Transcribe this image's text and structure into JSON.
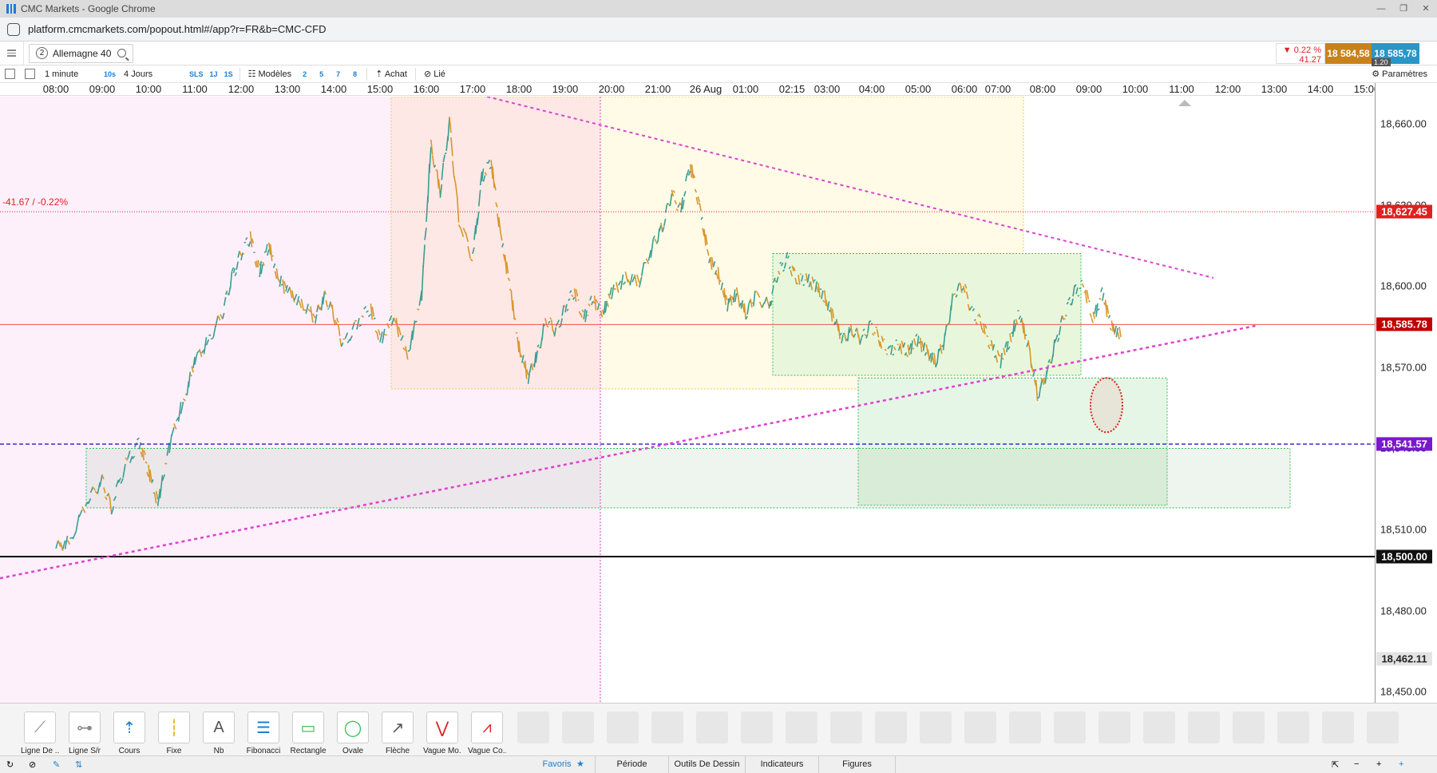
{
  "window": {
    "title": "CMC Markets - Google Chrome",
    "minimize": "—",
    "restore": "❐",
    "close": "✕"
  },
  "browser": {
    "url": "platform.cmcmarkets.com/popout.html#/app?r=FR&b=CMC-CFD"
  },
  "instrument": {
    "index": "2",
    "name": "Allemagne 40"
  },
  "quote": {
    "change_pct": "▼ 0.22 %",
    "change_pts": "41.27",
    "sell": "18 584,58",
    "buy": "18 585,78",
    "spread": "1.20"
  },
  "toolbar": {
    "interval": "1 minute",
    "sec": "10s",
    "range": "4 Jours",
    "sls": "SLS",
    "one_j": "1J",
    "one_s": "1S",
    "models": "Modèles",
    "layouts": [
      "2",
      "5",
      "7",
      "8"
    ],
    "buy": "Achat",
    "link": "Lié",
    "settings": "Paramètres"
  },
  "colors": {
    "accent": "#1b7fd1",
    "sell": "#c8821c",
    "buy": "#2a95c6",
    "down": "#e02020",
    "purple": "#8a1bd6"
  },
  "chart_data": {
    "type": "candlestick",
    "instrument": "Allemagne 40",
    "x_ticks": [
      "08:00",
      "09:00",
      "10:00",
      "11:00",
      "12:00",
      "13:00",
      "14:00",
      "15:00",
      "16:00",
      "17:00",
      "18:00",
      "19:00",
      "20:00",
      "21:00",
      "26 Aug",
      "01:00",
      "02:15",
      "03:00",
      "04:00",
      "05:00",
      "06:00",
      "07:00",
      "08:00",
      "09:00",
      "10:00",
      "11:00",
      "12:00",
      "13:00",
      "14:00",
      "15:00"
    ],
    "y_ticks": [
      "18,660.00",
      "18,630.00",
      "18,600.00",
      "18,570.00",
      "18,540.00",
      "18,510.00",
      "18,480.00",
      "18,450.00"
    ],
    "ylim": [
      18446,
      18670
    ],
    "close_path": [
      [
        0,
        18503
      ],
      [
        0.3,
        18506
      ],
      [
        0.7,
        18521
      ],
      [
        1,
        18528
      ],
      [
        1.2,
        18518
      ],
      [
        1.5,
        18534
      ],
      [
        1.8,
        18542
      ],
      [
        2,
        18532
      ],
      [
        2.2,
        18520
      ],
      [
        2.5,
        18544
      ],
      [
        2.8,
        18560
      ],
      [
        3,
        18572
      ],
      [
        3.3,
        18580
      ],
      [
        3.6,
        18590
      ],
      [
        3.8,
        18603
      ],
      [
        4,
        18612
      ],
      [
        4.2,
        18618
      ],
      [
        4.4,
        18605
      ],
      [
        4.6,
        18615
      ],
      [
        4.8,
        18603
      ],
      [
        5,
        18598
      ],
      [
        5.3,
        18594
      ],
      [
        5.6,
        18588
      ],
      [
        5.8,
        18596
      ],
      [
        6,
        18590
      ],
      [
        6.2,
        18578
      ],
      [
        6.5,
        18586
      ],
      [
        6.8,
        18592
      ],
      [
        7,
        18580
      ],
      [
        7.3,
        18588
      ],
      [
        7.6,
        18575
      ],
      [
        7.9,
        18596
      ],
      [
        8.1,
        18652
      ],
      [
        8.3,
        18635
      ],
      [
        8.5,
        18660
      ],
      [
        8.7,
        18625
      ],
      [
        9,
        18610
      ],
      [
        9.2,
        18640
      ],
      [
        9.4,
        18646
      ],
      [
        9.6,
        18620
      ],
      [
        9.8,
        18600
      ],
      [
        10,
        18578
      ],
      [
        10.2,
        18566
      ],
      [
        10.4,
        18575
      ],
      [
        10.6,
        18588
      ],
      [
        10.8,
        18583
      ],
      [
        11,
        18592
      ],
      [
        11.2,
        18598
      ],
      [
        11.4,
        18588
      ],
      [
        11.6,
        18595
      ],
      [
        11.8,
        18590
      ],
      [
        12,
        18597
      ],
      [
        12.3,
        18603
      ],
      [
        12.6,
        18602
      ],
      [
        12.9,
        18615
      ],
      [
        13.1,
        18622
      ],
      [
        13.3,
        18634
      ],
      [
        13.5,
        18628
      ],
      [
        13.7,
        18645
      ],
      [
        13.9,
        18630
      ],
      [
        14.1,
        18610
      ],
      [
        14.3,
        18605
      ],
      [
        14.5,
        18593
      ],
      [
        14.7,
        18597
      ],
      [
        14.9,
        18590
      ],
      [
        15.1,
        18596
      ],
      [
        15.4,
        18593
      ],
      [
        15.6,
        18605
      ],
      [
        15.8,
        18610
      ],
      [
        16,
        18602
      ],
      [
        16.2,
        18603
      ],
      [
        16.4,
        18600
      ],
      [
        16.6,
        18596
      ],
      [
        16.8,
        18588
      ],
      [
        17,
        18580
      ],
      [
        17.2,
        18584
      ],
      [
        17.4,
        18580
      ],
      [
        17.6,
        18586
      ],
      [
        17.8,
        18580
      ],
      [
        18,
        18576
      ],
      [
        18.2,
        18578
      ],
      [
        18.4,
        18576
      ],
      [
        18.6,
        18580
      ],
      [
        18.8,
        18576
      ],
      [
        19,
        18572
      ],
      [
        19.2,
        18580
      ],
      [
        19.4,
        18598
      ],
      [
        19.6,
        18600
      ],
      [
        19.8,
        18590
      ],
      [
        20,
        18586
      ],
      [
        20.2,
        18578
      ],
      [
        20.4,
        18572
      ],
      [
        20.6,
        18580
      ],
      [
        20.8,
        18590
      ],
      [
        21,
        18578
      ],
      [
        21.2,
        18560
      ],
      [
        21.4,
        18567
      ],
      [
        21.6,
        18580
      ],
      [
        21.8,
        18590
      ],
      [
        22,
        18598
      ],
      [
        22.2,
        18600
      ],
      [
        22.4,
        18588
      ],
      [
        22.6,
        18597
      ],
      [
        22.8,
        18585
      ],
      [
        23,
        18582
      ]
    ],
    "annotations": [
      {
        "kind": "hline",
        "value": 18627.45,
        "label": "18,627.45",
        "style": "dotted-red"
      },
      {
        "kind": "hline",
        "value": 18585.78,
        "label": "18,585.78",
        "style": "solid-red"
      },
      {
        "kind": "hline",
        "value": 18541.57,
        "label": "18,541.57",
        "style": "dashed-purple"
      },
      {
        "kind": "hline",
        "value": 18500.0,
        "label": "18,500.00",
        "style": "solid-black"
      },
      {
        "kind": "hline",
        "value": 18462.11,
        "label": "18,462.11",
        "style": "gray"
      }
    ],
    "change_label": "-41.67 / -0.22%"
  },
  "drawing_tools": [
    {
      "label": "Ligne De ...",
      "icon": "line-icon"
    },
    {
      "label": "Ligne S/r",
      "icon": "hline-icon"
    },
    {
      "label": "Cours",
      "icon": "price-icon"
    },
    {
      "label": "Fixe",
      "icon": "fixed-icon"
    },
    {
      "label": "Nb",
      "icon": "text-icon"
    },
    {
      "label": "Fibonacci",
      "icon": "fibonacci-icon"
    },
    {
      "label": "Rectangle",
      "icon": "rectangle-icon"
    },
    {
      "label": "Ovale",
      "icon": "oval-icon"
    },
    {
      "label": "Flèche",
      "icon": "arrow-icon"
    },
    {
      "label": "Vague Mo...",
      "icon": "wave-icon"
    },
    {
      "label": "Vague Co...",
      "icon": "wave2-icon"
    }
  ],
  "bottom_tabs": [
    "Favoris",
    "Période",
    "Outils De Dessin",
    "Indicateurs",
    "Figures"
  ],
  "bottom_controls": [
    "+",
    "−",
    "+",
    "⇱"
  ]
}
